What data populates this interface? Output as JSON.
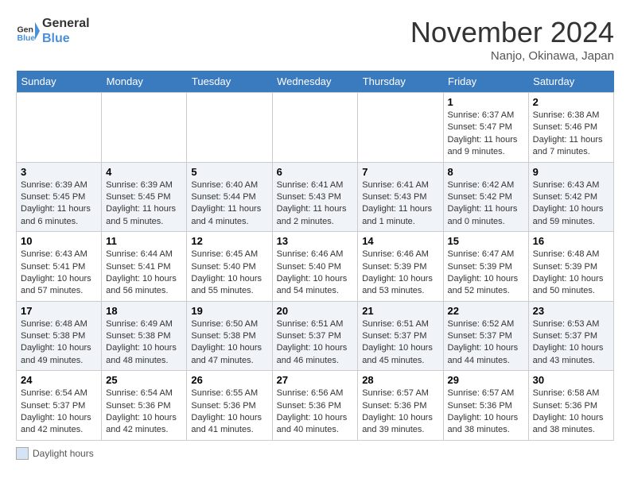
{
  "header": {
    "logo_line1": "General",
    "logo_line2": "Blue",
    "month": "November 2024",
    "location": "Nanjo, Okinawa, Japan"
  },
  "days_of_week": [
    "Sunday",
    "Monday",
    "Tuesday",
    "Wednesday",
    "Thursday",
    "Friday",
    "Saturday"
  ],
  "weeks": [
    [
      {
        "num": "",
        "info": ""
      },
      {
        "num": "",
        "info": ""
      },
      {
        "num": "",
        "info": ""
      },
      {
        "num": "",
        "info": ""
      },
      {
        "num": "",
        "info": ""
      },
      {
        "num": "1",
        "info": "Sunrise: 6:37 AM\nSunset: 5:47 PM\nDaylight: 11 hours and 9 minutes."
      },
      {
        "num": "2",
        "info": "Sunrise: 6:38 AM\nSunset: 5:46 PM\nDaylight: 11 hours and 7 minutes."
      }
    ],
    [
      {
        "num": "3",
        "info": "Sunrise: 6:39 AM\nSunset: 5:45 PM\nDaylight: 11 hours and 6 minutes."
      },
      {
        "num": "4",
        "info": "Sunrise: 6:39 AM\nSunset: 5:45 PM\nDaylight: 11 hours and 5 minutes."
      },
      {
        "num": "5",
        "info": "Sunrise: 6:40 AM\nSunset: 5:44 PM\nDaylight: 11 hours and 4 minutes."
      },
      {
        "num": "6",
        "info": "Sunrise: 6:41 AM\nSunset: 5:43 PM\nDaylight: 11 hours and 2 minutes."
      },
      {
        "num": "7",
        "info": "Sunrise: 6:41 AM\nSunset: 5:43 PM\nDaylight: 11 hours and 1 minute."
      },
      {
        "num": "8",
        "info": "Sunrise: 6:42 AM\nSunset: 5:42 PM\nDaylight: 11 hours and 0 minutes."
      },
      {
        "num": "9",
        "info": "Sunrise: 6:43 AM\nSunset: 5:42 PM\nDaylight: 10 hours and 59 minutes."
      }
    ],
    [
      {
        "num": "10",
        "info": "Sunrise: 6:43 AM\nSunset: 5:41 PM\nDaylight: 10 hours and 57 minutes."
      },
      {
        "num": "11",
        "info": "Sunrise: 6:44 AM\nSunset: 5:41 PM\nDaylight: 10 hours and 56 minutes."
      },
      {
        "num": "12",
        "info": "Sunrise: 6:45 AM\nSunset: 5:40 PM\nDaylight: 10 hours and 55 minutes."
      },
      {
        "num": "13",
        "info": "Sunrise: 6:46 AM\nSunset: 5:40 PM\nDaylight: 10 hours and 54 minutes."
      },
      {
        "num": "14",
        "info": "Sunrise: 6:46 AM\nSunset: 5:39 PM\nDaylight: 10 hours and 53 minutes."
      },
      {
        "num": "15",
        "info": "Sunrise: 6:47 AM\nSunset: 5:39 PM\nDaylight: 10 hours and 52 minutes."
      },
      {
        "num": "16",
        "info": "Sunrise: 6:48 AM\nSunset: 5:39 PM\nDaylight: 10 hours and 50 minutes."
      }
    ],
    [
      {
        "num": "17",
        "info": "Sunrise: 6:48 AM\nSunset: 5:38 PM\nDaylight: 10 hours and 49 minutes."
      },
      {
        "num": "18",
        "info": "Sunrise: 6:49 AM\nSunset: 5:38 PM\nDaylight: 10 hours and 48 minutes."
      },
      {
        "num": "19",
        "info": "Sunrise: 6:50 AM\nSunset: 5:38 PM\nDaylight: 10 hours and 47 minutes."
      },
      {
        "num": "20",
        "info": "Sunrise: 6:51 AM\nSunset: 5:37 PM\nDaylight: 10 hours and 46 minutes."
      },
      {
        "num": "21",
        "info": "Sunrise: 6:51 AM\nSunset: 5:37 PM\nDaylight: 10 hours and 45 minutes."
      },
      {
        "num": "22",
        "info": "Sunrise: 6:52 AM\nSunset: 5:37 PM\nDaylight: 10 hours and 44 minutes."
      },
      {
        "num": "23",
        "info": "Sunrise: 6:53 AM\nSunset: 5:37 PM\nDaylight: 10 hours and 43 minutes."
      }
    ],
    [
      {
        "num": "24",
        "info": "Sunrise: 6:54 AM\nSunset: 5:37 PM\nDaylight: 10 hours and 42 minutes."
      },
      {
        "num": "25",
        "info": "Sunrise: 6:54 AM\nSunset: 5:36 PM\nDaylight: 10 hours and 42 minutes."
      },
      {
        "num": "26",
        "info": "Sunrise: 6:55 AM\nSunset: 5:36 PM\nDaylight: 10 hours and 41 minutes."
      },
      {
        "num": "27",
        "info": "Sunrise: 6:56 AM\nSunset: 5:36 PM\nDaylight: 10 hours and 40 minutes."
      },
      {
        "num": "28",
        "info": "Sunrise: 6:57 AM\nSunset: 5:36 PM\nDaylight: 10 hours and 39 minutes."
      },
      {
        "num": "29",
        "info": "Sunrise: 6:57 AM\nSunset: 5:36 PM\nDaylight: 10 hours and 38 minutes."
      },
      {
        "num": "30",
        "info": "Sunrise: 6:58 AM\nSunset: 5:36 PM\nDaylight: 10 hours and 38 minutes."
      }
    ]
  ],
  "legend": {
    "label": "Daylight hours"
  }
}
